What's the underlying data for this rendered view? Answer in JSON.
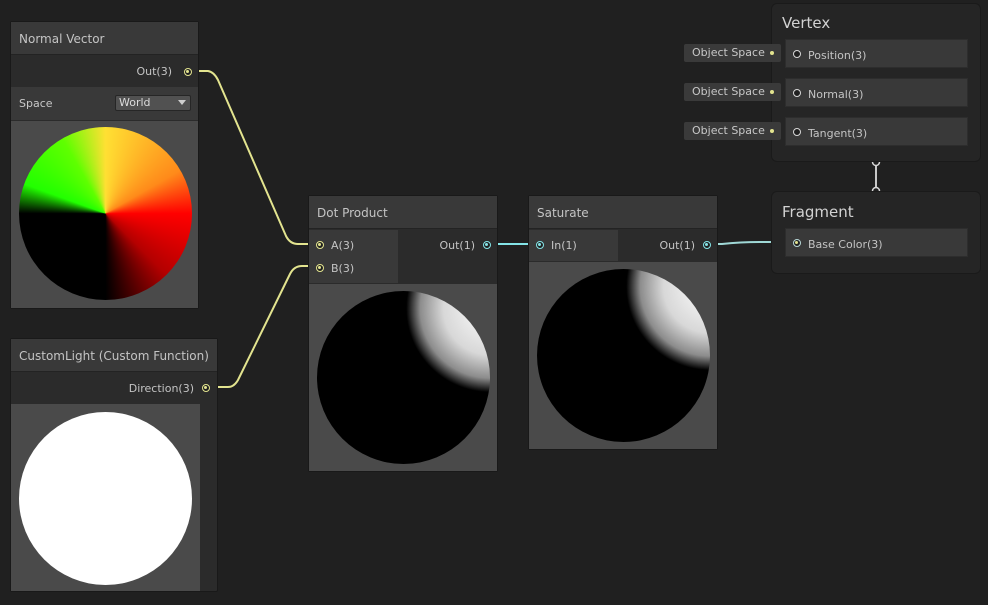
{
  "nodes": {
    "normal_vector": {
      "title": "Normal Vector",
      "output_label": "Out(3)",
      "space_label": "Space",
      "space_value": "World"
    },
    "custom_light": {
      "title": "CustomLight (Custom Function)",
      "output_label": "Direction(3)"
    },
    "dot_product": {
      "title": "Dot Product",
      "input_a": "A(3)",
      "input_b": "B(3)",
      "output_label": "Out(1)"
    },
    "saturate": {
      "title": "Saturate",
      "input_label": "In(1)",
      "output_label": "Out(1)"
    }
  },
  "master": {
    "vertex": {
      "title": "Vertex",
      "ports": [
        {
          "label": "Position(3)",
          "space": "Object Space"
        },
        {
          "label": "Normal(3)",
          "space": "Object Space"
        },
        {
          "label": "Tangent(3)",
          "space": "Object Space"
        }
      ]
    },
    "fragment": {
      "title": "Fragment",
      "ports": [
        {
          "label": "Base Color(3)"
        }
      ]
    }
  },
  "colors": {
    "vector3_wire": "#e3e48f",
    "float_wire": "#84e4e7",
    "background": "#202020",
    "node_body": "#2b2b2b",
    "node_header": "#393939"
  }
}
